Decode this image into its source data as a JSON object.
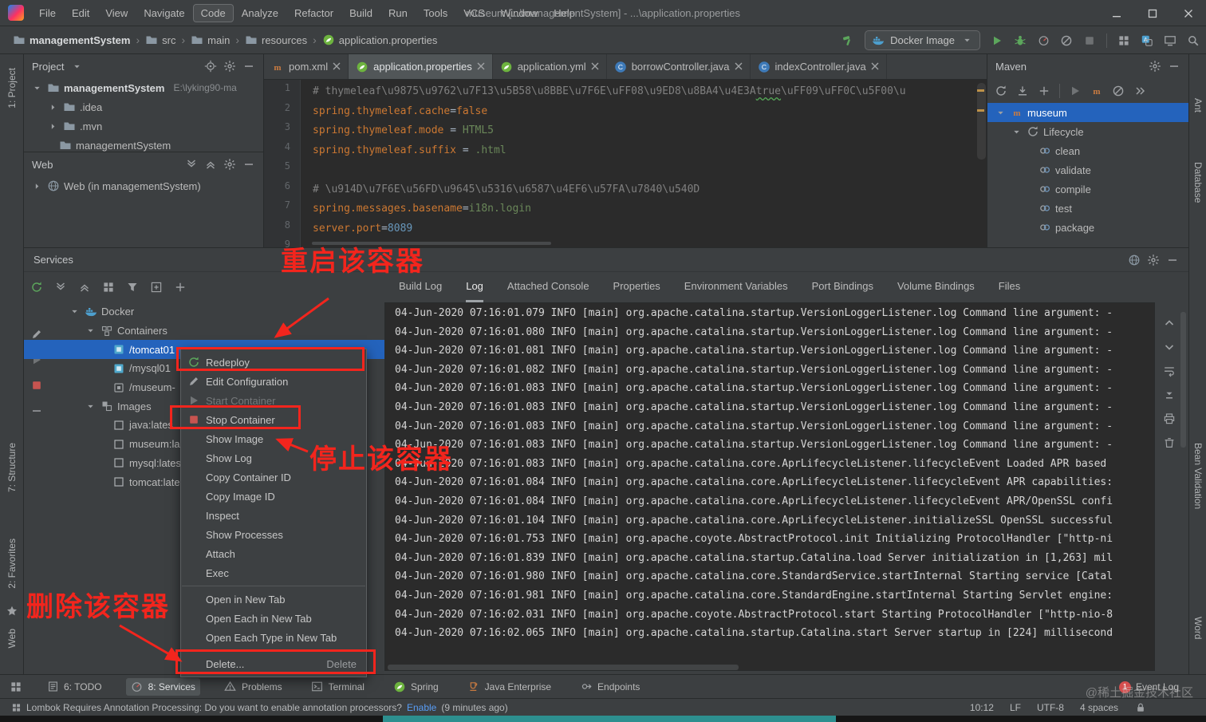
{
  "title_bar": {
    "menus": [
      "File",
      "Edit",
      "View",
      "Navigate",
      "Code",
      "Analyze",
      "Refactor",
      "Build",
      "Run",
      "Tools",
      "VCS",
      "Window",
      "Help"
    ],
    "highlighted_menu": "Code",
    "title": "museum [...\\managementSystem] - ...\\application.properties"
  },
  "nav_bar": {
    "breadcrumbs": [
      "managementSystem",
      "src",
      "main",
      "resources",
      "application.properties"
    ],
    "run_config": "Docker Image"
  },
  "left_strip": [
    "1: Project",
    "7: Structure",
    "2: Favorites",
    "Web"
  ],
  "right_strip": [
    "Ant",
    "Database",
    "Bean Validation",
    "Word"
  ],
  "project_panel": {
    "title": "Project",
    "rows": [
      {
        "indent": 0,
        "chevron": "down",
        "icon": "folder",
        "label": "managementSystem",
        "suffix": "E:\\lyking90-ma",
        "bold": true
      },
      {
        "indent": 1,
        "chevron": "right",
        "icon": "folder",
        "label": ".idea"
      },
      {
        "indent": 1,
        "chevron": "right",
        "icon": "folder",
        "label": ".mvn"
      },
      {
        "indent": 1,
        "chevron": "",
        "icon": "folder",
        "label": "managementSystem"
      }
    ]
  },
  "web_panel": {
    "title": "Web",
    "rows": [
      {
        "indent": 0,
        "chevron": "right",
        "icon": "web",
        "label": "Web (in managementSystem)"
      }
    ]
  },
  "editor": {
    "tabs": [
      {
        "label": "pom.xml",
        "icon": "maven",
        "active": false
      },
      {
        "label": "application.properties",
        "icon": "spring",
        "active": true
      },
      {
        "label": "application.yml",
        "icon": "spring",
        "active": false
      },
      {
        "label": "borrowController.java",
        "icon": "classicon",
        "active": false
      },
      {
        "label": "indexController.java",
        "icon": "classicon",
        "active": false
      }
    ],
    "lines": [
      {
        "n": "1",
        "seg": [
          [
            "comment",
            "# thymeleaf\\u9875\\u9762\\u7F13\\u5B58\\u8BBE\\u7F6E\\uFF08\\u9ED8\\u8BA4\\u4E3A"
          ],
          [
            "comment typo",
            "true"
          ],
          [
            "comment",
            "\\uFF09\\uFF0C\\u5F00\\u"
          ]
        ]
      },
      {
        "n": "2",
        "seg": [
          [
            "key",
            "spring.thymeleaf.cache"
          ],
          [
            "eq",
            "="
          ],
          [
            "key",
            "false"
          ]
        ]
      },
      {
        "n": "3",
        "seg": [
          [
            "key",
            "spring.thymeleaf.mode"
          ],
          [
            "eq",
            " = "
          ],
          [
            "str",
            "HTML5"
          ]
        ]
      },
      {
        "n": "4",
        "seg": [
          [
            "key",
            "spring.thymeleaf.suffix"
          ],
          [
            "eq",
            " = "
          ],
          [
            "str",
            ".html"
          ]
        ]
      },
      {
        "n": "5",
        "seg": []
      },
      {
        "n": "6",
        "seg": [
          [
            "comment",
            "# \\u914D\\u7F6E\\u56FD\\u9645\\u5316\\u6587\\u4EF6\\u57FA\\u7840\\u540D"
          ]
        ]
      },
      {
        "n": "7",
        "seg": [
          [
            "key",
            "spring.messages.basename"
          ],
          [
            "eq",
            "="
          ],
          [
            "str",
            "i18n.login"
          ]
        ]
      },
      {
        "n": "8",
        "seg": [
          [
            "key",
            "server.port"
          ],
          [
            "eq",
            "="
          ],
          [
            "num",
            "8089"
          ]
        ]
      },
      {
        "n": "9",
        "seg": []
      }
    ]
  },
  "maven_panel": {
    "title": "Maven",
    "rows": [
      {
        "indent": 0,
        "chevron": "down",
        "icon": "maven",
        "label": "museum",
        "selected": true
      },
      {
        "indent": 1,
        "chevron": "down",
        "icon": "lifecycle",
        "label": "Lifecycle"
      },
      {
        "indent": 2,
        "chevron": "",
        "icon": "goal",
        "label": "clean"
      },
      {
        "indent": 2,
        "chevron": "",
        "icon": "goal",
        "label": "validate"
      },
      {
        "indent": 2,
        "chevron": "",
        "icon": "goal",
        "label": "compile"
      },
      {
        "indent": 2,
        "chevron": "",
        "icon": "goal",
        "label": "test"
      },
      {
        "indent": 2,
        "chevron": "",
        "icon": "goal",
        "label": "package"
      }
    ]
  },
  "services": {
    "title": "Services",
    "tree": [
      {
        "indent": 0,
        "chevron": "down",
        "icon": "docker",
        "label": "Docker"
      },
      {
        "indent": 1,
        "chevron": "down",
        "icon": "containers",
        "label": "Containers"
      },
      {
        "indent": 2,
        "chevron": "",
        "icon": "containeron",
        "label": "/tomcat01",
        "selected": true
      },
      {
        "indent": 2,
        "chevron": "",
        "icon": "containeron",
        "label": "/mysql01"
      },
      {
        "indent": 2,
        "chevron": "",
        "icon": "containeroff",
        "label": "/museum-"
      },
      {
        "indent": 1,
        "chevron": "down",
        "icon": "images",
        "label": "Images"
      },
      {
        "indent": 2,
        "chevron": "",
        "icon": "image",
        "label": "java:lates"
      },
      {
        "indent": 2,
        "chevron": "",
        "icon": "image",
        "label": "museum:la"
      },
      {
        "indent": 2,
        "chevron": "",
        "icon": "image",
        "label": "mysql:lates"
      },
      {
        "indent": 2,
        "chevron": "",
        "icon": "image",
        "label": "tomcat:late"
      }
    ],
    "tabs": [
      "Build Log",
      "Log",
      "Attached Console",
      "Properties",
      "Environment Variables",
      "Port Bindings",
      "Volume Bindings",
      "Files"
    ],
    "active_tab": "Log",
    "log": [
      "04-Jun-2020 07:16:01.079 INFO [main] org.apache.catalina.startup.VersionLoggerListener.log Command line argument: -",
      "04-Jun-2020 07:16:01.080 INFO [main] org.apache.catalina.startup.VersionLoggerListener.log Command line argument: -",
      "04-Jun-2020 07:16:01.081 INFO [main] org.apache.catalina.startup.VersionLoggerListener.log Command line argument: -",
      "04-Jun-2020 07:16:01.082 INFO [main] org.apache.catalina.startup.VersionLoggerListener.log Command line argument: -",
      "04-Jun-2020 07:16:01.083 INFO [main] org.apache.catalina.startup.VersionLoggerListener.log Command line argument: -",
      "04-Jun-2020 07:16:01.083 INFO [main] org.apache.catalina.startup.VersionLoggerListener.log Command line argument: -",
      "04-Jun-2020 07:16:01.083 INFO [main] org.apache.catalina.startup.VersionLoggerListener.log Command line argument: -",
      "04-Jun-2020 07:16:01.083 INFO [main] org.apache.catalina.startup.VersionLoggerListener.log Command line argument: -",
      "04-Jun-2020 07:16:01.083 INFO [main] org.apache.catalina.core.AprLifecycleListener.lifecycleEvent Loaded APR based",
      "04-Jun-2020 07:16:01.084 INFO [main] org.apache.catalina.core.AprLifecycleListener.lifecycleEvent APR capabilities:",
      "04-Jun-2020 07:16:01.084 INFO [main] org.apache.catalina.core.AprLifecycleListener.lifecycleEvent APR/OpenSSL confi",
      "04-Jun-2020 07:16:01.104 INFO [main] org.apache.catalina.core.AprLifecycleListener.initializeSSL OpenSSL successful",
      "04-Jun-2020 07:16:01.753 INFO [main] org.apache.coyote.AbstractProtocol.init Initializing ProtocolHandler [\"http-ni",
      "04-Jun-2020 07:16:01.839 INFO [main] org.apache.catalina.startup.Catalina.load Server initialization in [1,263] mil",
      "04-Jun-2020 07:16:01.980 INFO [main] org.apache.catalina.core.StandardService.startInternal Starting service [Catal",
      "04-Jun-2020 07:16:01.981 INFO [main] org.apache.catalina.core.StandardEngine.startInternal Starting Servlet engine:",
      "04-Jun-2020 07:16:02.031 INFO [main] org.apache.coyote.AbstractProtocol.start Starting ProtocolHandler [\"http-nio-8",
      "04-Jun-2020 07:16:02.065 INFO [main] org.apache.catalina.startup.Catalina.start Server startup in [224] millisecond"
    ]
  },
  "context_menu": {
    "items": [
      {
        "label": "Redeploy",
        "icon": "redeploy"
      },
      {
        "label": "Edit Configuration",
        "icon": "pencil"
      },
      {
        "label": "Start Container",
        "icon": "playgray",
        "disabled": true
      },
      {
        "label": "Stop Container",
        "icon": "stopred"
      },
      {
        "label": "Show Image"
      },
      {
        "label": "Show Log"
      },
      {
        "label": "Copy Container ID"
      },
      {
        "label": "Copy Image ID"
      },
      {
        "label": "Inspect"
      },
      {
        "label": "Show Processes"
      },
      {
        "label": "Attach"
      },
      {
        "label": "Exec"
      },
      {
        "separator": true
      },
      {
        "label": "Open in New Tab"
      },
      {
        "label": "Open Each in New Tab"
      },
      {
        "label": "Open Each Type in New Tab"
      },
      {
        "separator": true
      },
      {
        "label": "Delete...",
        "shortcut": "Delete"
      }
    ]
  },
  "annotations": {
    "restart": "重启该容器",
    "stop": "停止该容器",
    "delete": "删除该容器"
  },
  "bottom_bar": {
    "left": [
      {
        "label": "6: TODO",
        "icon": "todo"
      },
      {
        "label": "8: Services",
        "icon": "gauge",
        "active": true
      },
      {
        "label": "Problems",
        "icon": "warning"
      },
      {
        "label": "Terminal",
        "icon": "terminal"
      },
      {
        "label": "Spring",
        "icon": "spring"
      },
      {
        "label": "Java Enterprise",
        "icon": "javaee"
      },
      {
        "label": "Endpoints",
        "icon": "endpoints"
      }
    ],
    "event_log": {
      "label": "Event Log",
      "badge": "1"
    }
  },
  "status_bar": {
    "message_prefix": "Lombok Requires Annotation Processing: Do you want to enable annotation processors? ",
    "link": "Enable",
    "suffix": " (9 minutes ago)",
    "right": [
      "10:12",
      "LF",
      "UTF-8",
      "4 spaces"
    ]
  },
  "watermark": "@稀土掘金技术社区"
}
